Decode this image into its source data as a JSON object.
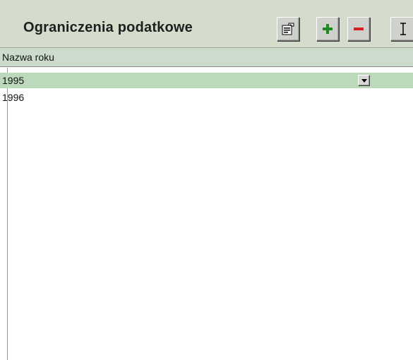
{
  "header": {
    "title": "Ograniczenia podatkowe",
    "buttons": [
      {
        "icon": "properties-icon"
      },
      {
        "icon": "add-icon",
        "color": "#1f8a1f"
      },
      {
        "icon": "remove-icon",
        "color": "#d82020"
      },
      {
        "icon": "text-cursor-icon"
      }
    ]
  },
  "table": {
    "column_header": "Nazwa roku",
    "rows": [
      {
        "value": "1995",
        "selected": true
      },
      {
        "value": "1996",
        "selected": false
      }
    ]
  },
  "colors": {
    "header_bg": "#d4dccc",
    "selected_row": "#bcd9bc",
    "column_header_bg": "#ccdccc"
  }
}
